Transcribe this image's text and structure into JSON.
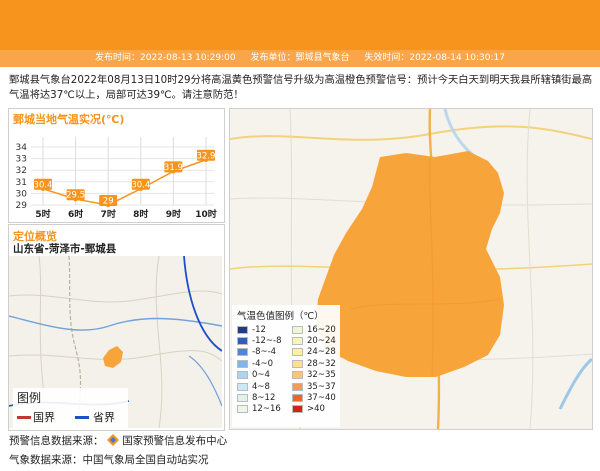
{
  "header": {
    "publish_time": "发布时间：2022-08-13 10:29:00",
    "publisher": "发布单位：鄄城县气象台",
    "expire_time": "失效时间：2022-08-14 10:30:17"
  },
  "notice": "鄄城县气象台2022年08月13日10时29分将高温黄色预警信号升级为高温橙色预警信号：预计今天白天到明天我县所辖镇街最高气温将达37℃以上，局部可达39℃。请注意防范！",
  "colors": {
    "accent": "#f7941d",
    "bar": "#f9a54a",
    "warning_area": "#f7a53a"
  },
  "chart_data": {
    "type": "line",
    "title": "鄄城当地气温实况(℃)",
    "categories": [
      "5时",
      "6时",
      "7时",
      "8时",
      "9时",
      "10时"
    ],
    "values": [
      30.4,
      29.5,
      29,
      30.4,
      31.9,
      32.9
    ],
    "ylim": [
      29,
      34
    ],
    "yticks": [
      "34",
      "33",
      "32",
      "31",
      "30",
      "29"
    ],
    "grid": true
  },
  "overview": {
    "title": "定位概览",
    "location": "山东省-菏泽市-鄄城县",
    "legend_title": "图例",
    "national_border": "国界",
    "provincial_border": "省界"
  },
  "map_legend": {
    "title": "气温色值图例（℃）",
    "items": [
      {
        "label": "-12",
        "color": "#1f3c88"
      },
      {
        "label": "16~20",
        "color": "#eef6d8"
      },
      {
        "label": "-12~-8",
        "color": "#2f5fb0"
      },
      {
        "label": "20~24",
        "color": "#f3f7b8"
      },
      {
        "label": "-8~-4",
        "color": "#4d86d6"
      },
      {
        "label": "24~28",
        "color": "#fbf1a0"
      },
      {
        "label": "-4~0",
        "color": "#7fb5ea"
      },
      {
        "label": "28~32",
        "color": "#fce08a"
      },
      {
        "label": "0~4",
        "color": "#a8d5f2"
      },
      {
        "label": "32~35",
        "color": "#fcc37a"
      },
      {
        "label": "4~8",
        "color": "#c9e9f8"
      },
      {
        "label": "35~37",
        "color": "#f99a52"
      },
      {
        "label": "8~12",
        "color": "#dff3ea"
      },
      {
        "label": "37~40",
        "color": "#f2622b"
      },
      {
        "label": "12~16",
        "color": "#ecf8e6"
      },
      {
        "label": ">40",
        "color": "#d6201f"
      }
    ]
  },
  "footer": {
    "warning_source_label": "预警信息数据来源：",
    "warning_source_name": "国家预警信息发布中心",
    "weather_source": "气象数据来源：中国气象局全国自动站实况"
  }
}
